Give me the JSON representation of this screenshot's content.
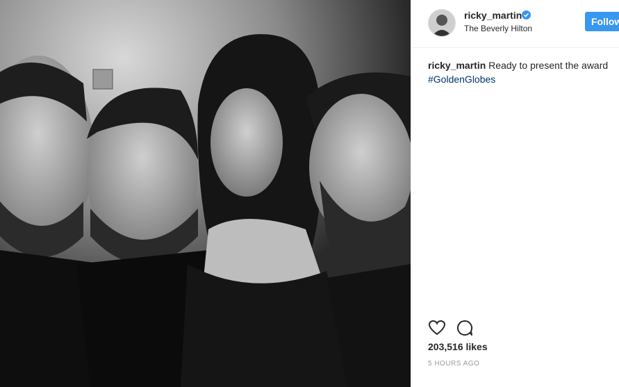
{
  "post": {
    "image_alt": "Black and white selfie of four people at an event"
  },
  "header": {
    "username": "ricky_martin",
    "location": "The Beverly Hilton",
    "follow_label": "Follow"
  },
  "caption": {
    "username": "ricky_martin",
    "text": " Ready to present the award",
    "hashtag": "#GoldenGlobes"
  },
  "stats": {
    "likes": "203,516 likes",
    "time": "5 HOURS AGO"
  },
  "icons": {
    "like": "heart-icon",
    "comment": "comment-icon",
    "verified": "verified-badge-icon"
  },
  "colors": {
    "accent": "#3897f0",
    "hashtag": "#003569"
  }
}
